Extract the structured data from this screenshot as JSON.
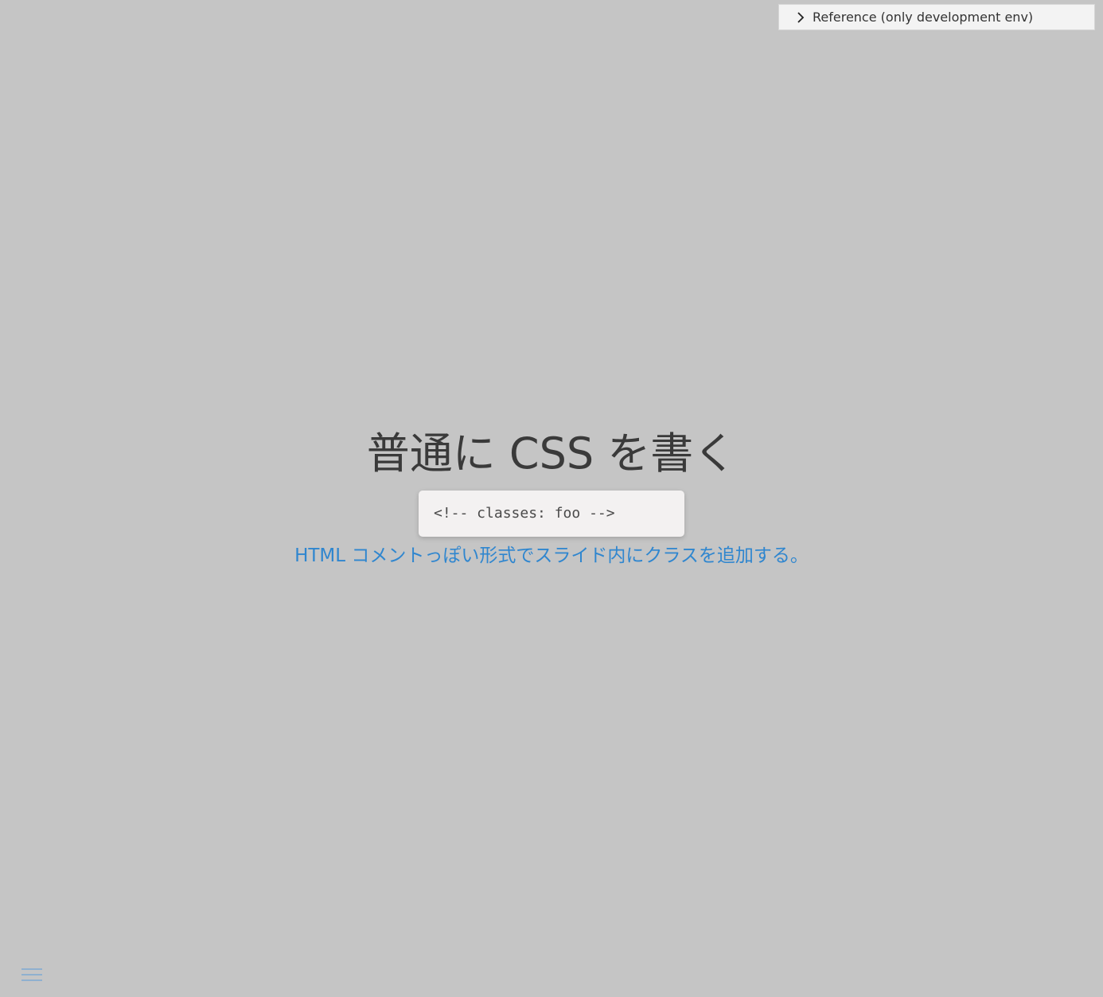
{
  "reference": {
    "label": "Reference (only development env)",
    "icon": "chevron-right-icon"
  },
  "slide": {
    "title": "普通に CSS を書く",
    "code": "<!-- classes: foo -->",
    "description": "HTML コメントっぽい形式でスライド内にクラスを追加する。"
  },
  "menu": {
    "icon": "hamburger-menu-icon"
  },
  "colors": {
    "background": "#c5c5c5",
    "title": "#3a3a3a",
    "accent": "#2f86cf",
    "code_bg": "#f3f1f1"
  }
}
